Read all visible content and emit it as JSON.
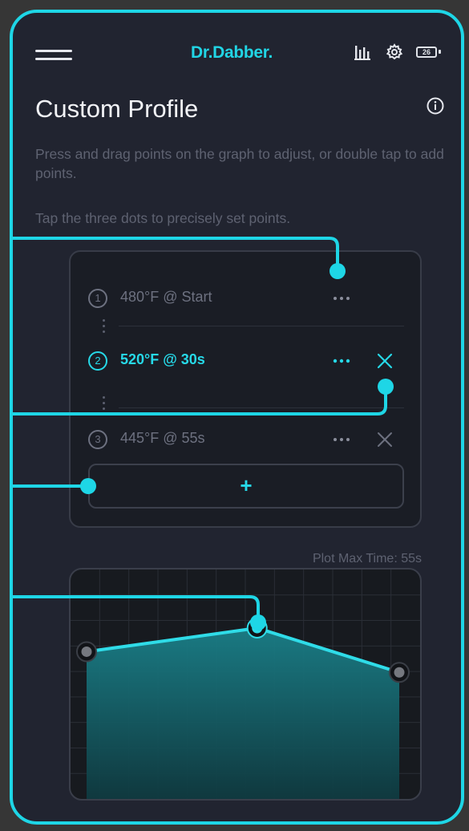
{
  "header": {
    "brand": "Dr.Dabber.",
    "battery_level": "26",
    "icons": [
      "menu-icon",
      "bar-chart-icon",
      "gear-icon",
      "battery-icon"
    ]
  },
  "page": {
    "title": "Custom Profile",
    "description_1": "Press and drag points on the graph to adjust, or double tap to add points.",
    "description_2": "Tap the three dots to precisely set points."
  },
  "points": [
    {
      "number": "1",
      "label": "480°F @ Start",
      "active": false
    },
    {
      "number": "2",
      "label": "520°F @ 30s",
      "active": true
    },
    {
      "number": "3",
      "label": "445°F @ 55s",
      "active": false
    }
  ],
  "add_button": {
    "label": "+"
  },
  "plot": {
    "max_time_label": "Plot Max Time: 55s",
    "points": [
      {
        "time_s": 0,
        "temp_f": 480
      },
      {
        "time_s": 30,
        "temp_f": 520
      },
      {
        "time_s": 55,
        "temp_f": 445
      }
    ],
    "selected_index": 1
  },
  "colors": {
    "accent": "#21d5e5",
    "background": "#212430",
    "panel": "#1a1d25",
    "muted_text": "#5e6271"
  }
}
